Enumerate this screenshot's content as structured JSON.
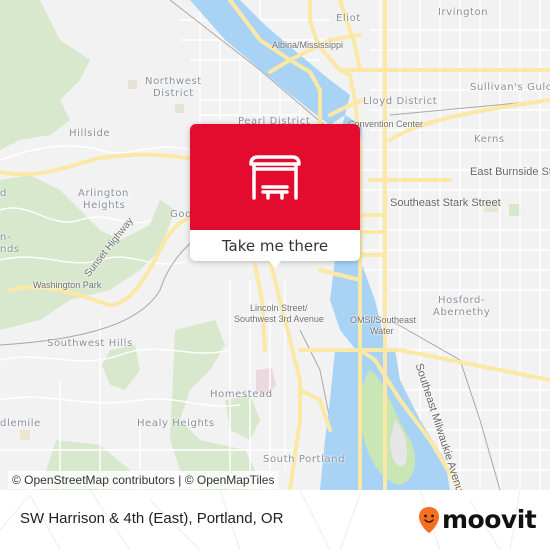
{
  "map": {
    "colors": {
      "background": "#f2f2f2",
      "water": "#a9d3f5",
      "park": "#d6e8c8",
      "major_road": "#fbe8a6",
      "minor_road": "#ffffff",
      "rail": "#a8a8a8"
    },
    "labels": {
      "eliot": "Eliot",
      "irvington": "Irvington",
      "albina": "Albina/Mississippi",
      "sullivans_gulch": "Sullivan's Gulch",
      "northwest_district_1": "Northwest",
      "northwest_district_2": "District",
      "lloyd_district": "Lloyd District",
      "pearl_district": "Pearl District",
      "convention_center": "Convention Center",
      "kerns": "Kerns",
      "hillside": "Hillside",
      "east_burnside": "East Burnside Street",
      "arlington_heights_1": "Arlington",
      "arlington_heights_2": "Heights",
      "goose_hollow": "Goo",
      "southeast_stark": "Southeast Stark Street",
      "hillside_west_1": "n-",
      "hillside_west_2": "nds",
      "sunset_highway": "Sunset Highway",
      "washington_park": "Washington Park",
      "lincoln_street_1": "Lincoln Street/",
      "lincoln_street_2": "Southwest 3rd Avenue",
      "omsi_1": "OMSI/Southeast",
      "omsi_2": "Water",
      "hosford_1": "Hosford-",
      "hosford_2": "Abernethy",
      "southwest_hills": "Southwest Hills",
      "homestead": "Homestead",
      "milwaukie_ave": "Southeast Milwaukie Avenue",
      "marquam": "dlemile",
      "healy_heights": "Healy Heights",
      "south_portland": "South Portland",
      "west_edge": "d"
    },
    "attribution": "© OpenStreetMap contributors | © OpenMapTiles"
  },
  "popup": {
    "icon": "bus-stop-shelter-icon",
    "color": "#e30b2e",
    "cta_label": "Take me there"
  },
  "footer": {
    "stop_name": "SW Harrison & 4th (East), Portland, OR",
    "brand": "moovit",
    "brand_color": "#f36f21"
  }
}
